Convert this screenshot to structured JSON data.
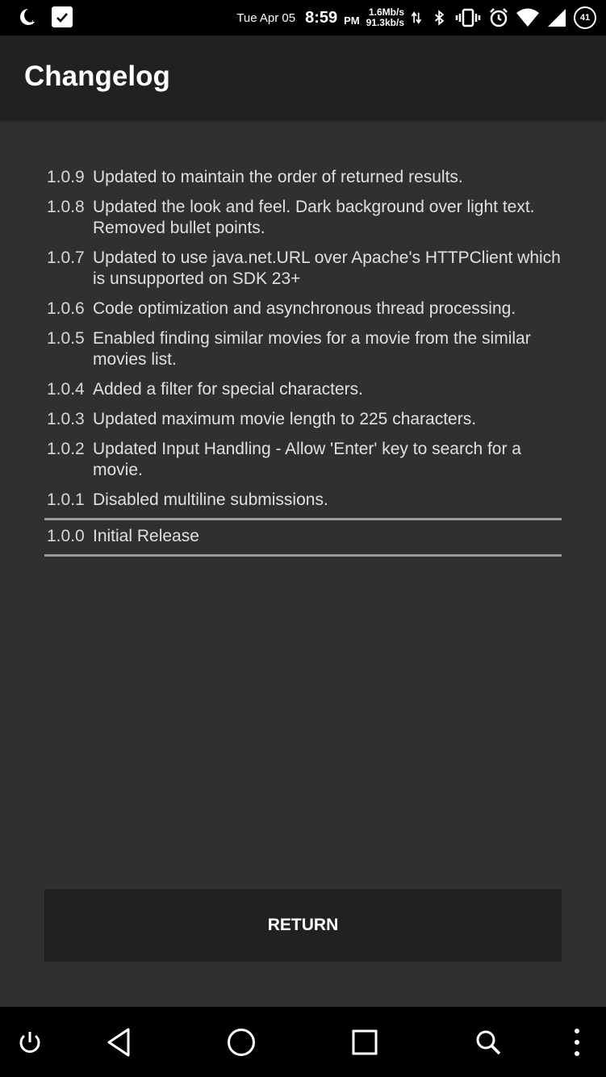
{
  "status_bar": {
    "date": "Tue Apr 05",
    "time": "8:59",
    "ampm": "PM",
    "download_speed": "1.6Mb/s",
    "upload_speed": "91.3kb/s",
    "battery_level": "41",
    "icons": [
      "moon-icon",
      "task-check-icon",
      "data-transfer-icon",
      "bluetooth-icon",
      "vibrate-icon",
      "alarm-icon",
      "wifi-icon",
      "cell-signal-icon",
      "battery-icon"
    ]
  },
  "app_bar": {
    "title": "Changelog"
  },
  "changelog": [
    {
      "version": "1.0.9",
      "text": "Updated to maintain the order of returned results."
    },
    {
      "version": "1.0.8",
      "text": "Updated the look and feel. Dark background over light text. Removed bullet points."
    },
    {
      "version": "1.0.7",
      "text": "Updated to use java.net.URL over Apache's HTTPClient which is unsupported on SDK 23+"
    },
    {
      "version": "1.0.6",
      "text": "Code optimization and asynchronous thread processing."
    },
    {
      "version": "1.0.5",
      "text": "Enabled finding similar movies for a movie from the similar movies list."
    },
    {
      "version": "1.0.4",
      "text": "Added a filter for special characters."
    },
    {
      "version": "1.0.3",
      "text": "Updated maximum movie length to 225 characters."
    },
    {
      "version": "1.0.2",
      "text": "Updated Input Handling - Allow 'Enter' key to search for a movie."
    },
    {
      "version": "1.0.1",
      "text": "Disabled multiline submissions."
    },
    {
      "version": "1.0.0",
      "text": "Initial Release"
    }
  ],
  "return_button": {
    "label": "RETURN"
  },
  "nav_bar": {
    "icons": [
      "power-icon",
      "back-icon",
      "home-icon",
      "recents-icon",
      "search-icon",
      "more-vert-icon"
    ]
  }
}
